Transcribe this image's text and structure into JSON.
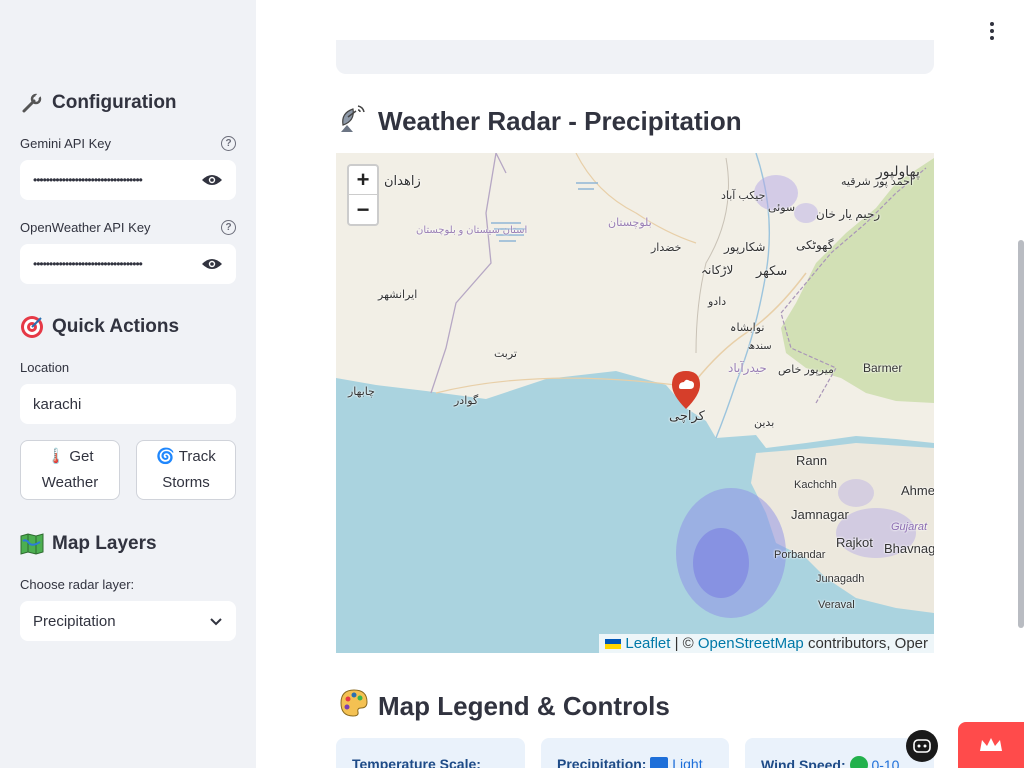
{
  "sidebar": {
    "config_title": "Configuration",
    "gemini_label": "Gemini API Key",
    "gemini_value": "••••••••••••••••••••••••••••••••••",
    "openweather_label": "OpenWeather API Key",
    "openweather_value": "••••••••••••••••••••••••••••••••••",
    "quick_title": "Quick Actions",
    "location_label": "Location",
    "location_value": "karachi",
    "get_weather_label": "🌡️ Get Weather",
    "track_storms_label": "🌀 Track Storms",
    "layers_title": "Map Layers",
    "radar_label": "Choose radar layer:",
    "radar_selected": "Precipitation"
  },
  "main": {
    "radar_title": "Weather Radar - Precipitation",
    "legend_title": "Map Legend & Controls",
    "map": {
      "zoom_in": "+",
      "zoom_out": "−",
      "attribution_leaflet": "Leaflet",
      "attribution_sep": " | © ",
      "attribution_osm": "OpenStreetMap",
      "attribution_rest": " contributors, Oper",
      "places": [
        "پهاولپور",
        "زاهدان",
        "احمد پور شرقیه",
        "سوئی",
        "جیکب آباد",
        "رحیم یار خان",
        "بلوچستان",
        "استان سیستان و بلوچستان",
        "خضدار",
        "شکارپور",
        "گھوٹکی",
        "لاڑکانہ",
        "سکھر",
        "ایرانشهر",
        "دادو",
        "نوابشاہ",
        "سندھ",
        "تربت",
        "حیدرآباد",
        "میرپور خاص",
        "Barmer",
        "چابهار",
        "گوادر",
        "کراچی",
        "بدین",
        "Rann",
        "Kachchh",
        "Ahme",
        "Jamnagar",
        "Rajkot",
        "Bhavnag",
        "Gujarat",
        "Porbandar",
        "Junagadh",
        "Veraval"
      ]
    },
    "cards": [
      {
        "label": "Temperature Scale:",
        "extra": ""
      },
      {
        "label": "Precipitation:",
        "extra": "Light"
      },
      {
        "label": "Wind Speed:",
        "extra": "0-10"
      }
    ]
  },
  "colors": {
    "sidebar_bg": "#f0f2f6",
    "accent": "#ff4b4b",
    "sea": "#aad3df",
    "land": "#f2efe6",
    "link": "#0078a8"
  }
}
